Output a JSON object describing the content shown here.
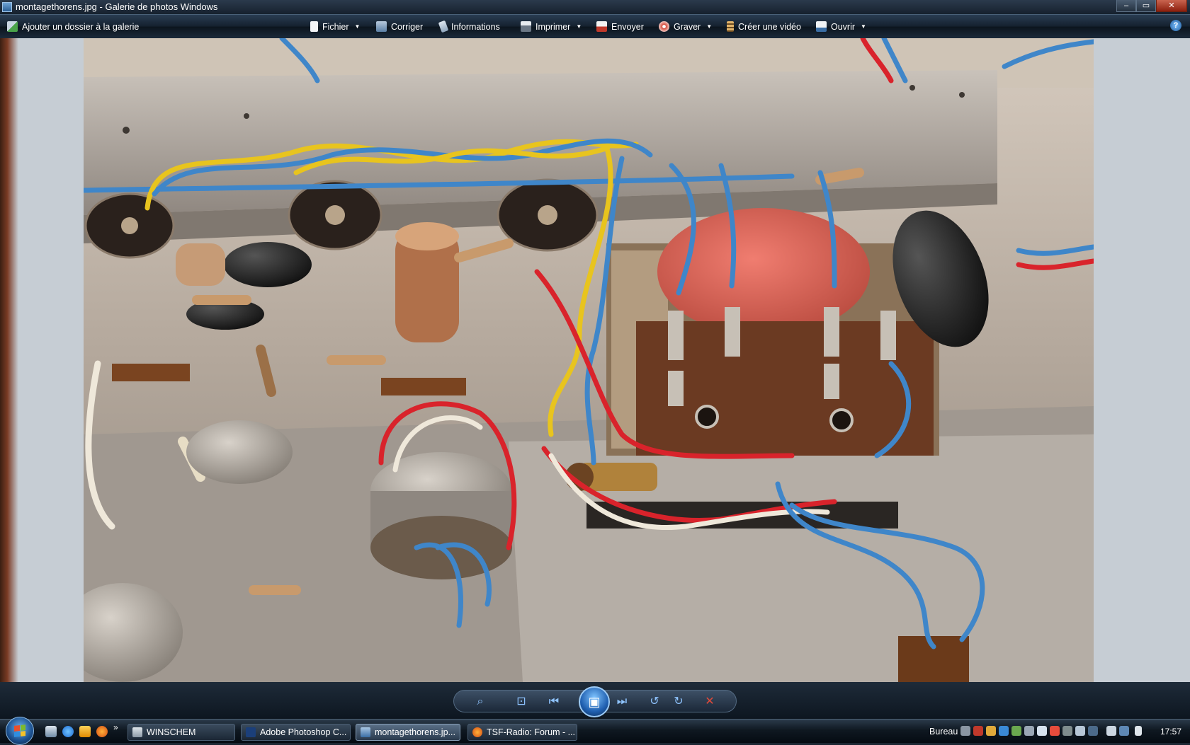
{
  "window": {
    "title": "montagethorens.jpg - Galerie de photos Windows",
    "controls": {
      "minimize": "–",
      "maximize": "▭",
      "close": "✕"
    }
  },
  "toolbar": {
    "add_folder": "Ajouter un dossier à la galerie",
    "items": [
      {
        "label": "Fichier",
        "dropdown": true,
        "icon": "file-icon"
      },
      {
        "label": "Corriger",
        "dropdown": false,
        "icon": "fix-icon"
      },
      {
        "label": "Informations",
        "dropdown": false,
        "icon": "info-icon"
      },
      {
        "label": "Imprimer",
        "dropdown": true,
        "icon": "print-icon"
      },
      {
        "label": "Envoyer",
        "dropdown": false,
        "icon": "email-icon"
      },
      {
        "label": "Graver",
        "dropdown": true,
        "icon": "burn-icon"
      },
      {
        "label": "Créer une vidéo",
        "dropdown": false,
        "icon": "movie-icon"
      },
      {
        "label": "Ouvrir",
        "dropdown": true,
        "icon": "open-icon"
      }
    ],
    "help": "?"
  },
  "viewer_controls": {
    "zoom": "⌕",
    "actual_size": "⊡",
    "previous": "⏮",
    "slideshow": "▣",
    "next": "⏭",
    "rotate_left": "↺",
    "rotate_right": "↻",
    "delete": "✕"
  },
  "taskbar": {
    "tasks": [
      {
        "label": "WINSCHEM",
        "active": false
      },
      {
        "label": "Adobe Photoshop C...",
        "active": false
      },
      {
        "label": "montagethorens.jp...",
        "active": true
      },
      {
        "label": "TSF-Radio: Forum - ...",
        "active": false
      }
    ],
    "desktop_label": "Bureau",
    "expand": "»",
    "clock": "17:57"
  },
  "colors": {
    "wire_blue": "#3f86c9",
    "wire_yellow": "#e8c41e",
    "wire_red": "#d9232b",
    "wire_white": "#efe8da",
    "chassis": "#a7a29c"
  }
}
